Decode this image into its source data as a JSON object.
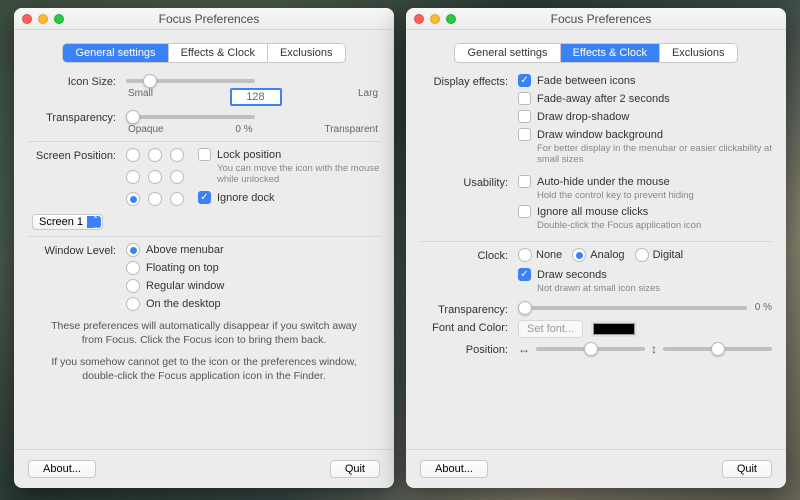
{
  "window_title": "Focus Preferences",
  "tabs": {
    "general": "General settings",
    "effects": "Effects & Clock",
    "exclusions": "Exclusions"
  },
  "left": {
    "icon_size": {
      "label": "Icon Size:",
      "min": "Small",
      "value": "128",
      "max": "Larg"
    },
    "transparency": {
      "label": "Transparency:",
      "min": "Opaque",
      "value": "0 %",
      "max": "Transparent"
    },
    "screen_pos": {
      "label": "Screen Position:",
      "select": "Screen 1",
      "lock": "Lock position",
      "lock_sub": "You can move the icon with the mouse while unlocked",
      "ignore": "Ignore dock"
    },
    "window_level": {
      "label": "Window Level:",
      "opts": [
        "Above menubar",
        "Floating on top",
        "Regular window",
        "On the desktop"
      ]
    },
    "note1": "These preferences will automatically disappear if you switch away from Focus. Click the Focus icon to bring them back.",
    "note2": "If you somehow cannot get to the icon or the preferences window, double-click the Focus application icon in the Finder."
  },
  "right": {
    "display": {
      "label": "Display effects:",
      "opts": [
        {
          "t": "Fade between icons",
          "c": true
        },
        {
          "t": "Fade-away after 2 seconds",
          "c": false
        },
        {
          "t": "Draw drop-shadow",
          "c": false
        },
        {
          "t": "Draw window background",
          "c": false,
          "s": "For better display in the menubar or easier clickability at small sizes"
        }
      ]
    },
    "usability": {
      "label": "Usability:",
      "opts": [
        {
          "t": "Auto-hide under the mouse",
          "c": false,
          "s": "Hold the control key to prevent hiding"
        },
        {
          "t": "Ignore all mouse clicks",
          "c": false,
          "s": "Double-click the Focus application icon"
        }
      ]
    },
    "clock": {
      "label": "Clock:",
      "opts": [
        "None",
        "Analog",
        "Digital"
      ],
      "sel": 1,
      "seconds": "Draw seconds",
      "seconds_sub": "Not drawn at small icon sizes"
    },
    "transparency": {
      "label": "Transparency:",
      "value": "0 %"
    },
    "fontcolor": {
      "label": "Font and Color:",
      "setfont": "Set font..."
    },
    "position": {
      "label": "Position:"
    }
  },
  "footer": {
    "about": "About...",
    "quit": "Quit"
  }
}
